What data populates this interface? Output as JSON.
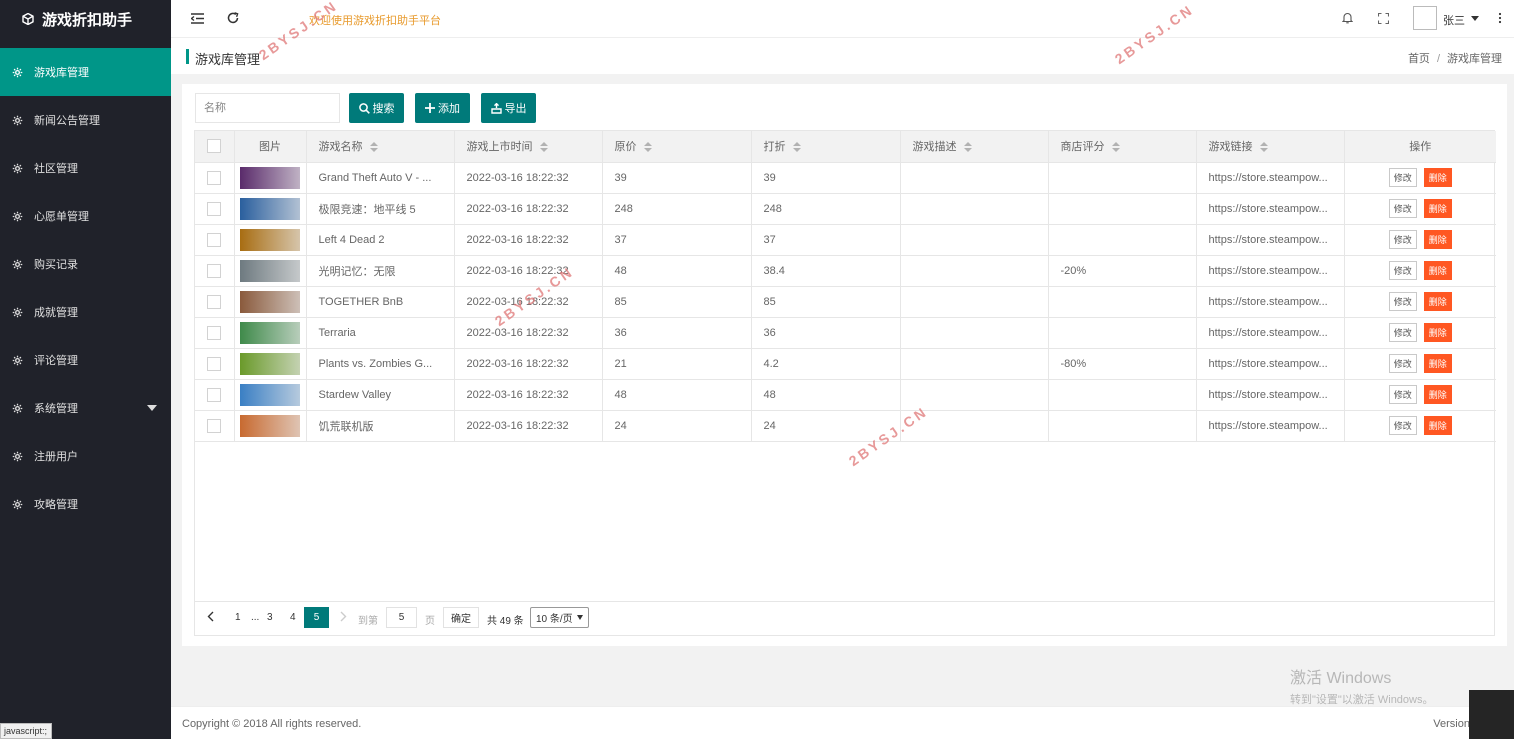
{
  "app": {
    "title": "游戏折扣助手"
  },
  "sidebar": {
    "items": [
      {
        "label": "游戏库管理",
        "active": true
      },
      {
        "label": "新闻公告管理"
      },
      {
        "label": "社区管理"
      },
      {
        "label": "心愿单管理"
      },
      {
        "label": "购买记录"
      },
      {
        "label": "成就管理"
      },
      {
        "label": "评论管理"
      },
      {
        "label": "系统管理",
        "expandable": true
      },
      {
        "label": "注册用户"
      },
      {
        "label": "攻略管理"
      }
    ]
  },
  "header": {
    "welcome": "欢迎使用游戏折扣助手平台",
    "user_name": "张三",
    "icons": [
      "menu-fold-icon",
      "refresh-icon",
      "bell-icon",
      "fullscreen-icon",
      "more-vertical-icon"
    ]
  },
  "page": {
    "title": "游戏库管理",
    "breadcrumb": [
      "首页",
      "游戏库管理"
    ]
  },
  "toolbar": {
    "search_placeholder": "名称",
    "search_label": "搜索",
    "add_label": "添加",
    "export_label": "导出"
  },
  "table": {
    "headers": {
      "image": "图片",
      "name": "游戏名称",
      "release": "游戏上市时间",
      "price": "原价",
      "discount": "打折",
      "desc": "游戏描述",
      "rating": "商店评分",
      "link": "游戏链接",
      "ops": "操作"
    },
    "edit_label": "修改",
    "delete_label": "删除",
    "rows": [
      {
        "name": "Grand Theft Auto V - ...",
        "release": "2022-03-16 18:22:32",
        "price": "39",
        "discount": "39",
        "desc": "",
        "rating": "",
        "link": "https://store.steampow...",
        "thumb_color": "#5a2b6b"
      },
      {
        "name": "极限竞速：地平线 5",
        "release": "2022-03-16 18:22:32",
        "price": "248",
        "discount": "248",
        "desc": "",
        "rating": "",
        "link": "https://store.steampow...",
        "thumb_color": "#2a5f9e"
      },
      {
        "name": "Left 4 Dead 2",
        "release": "2022-03-16 18:22:32",
        "price": "37",
        "discount": "37",
        "desc": "",
        "rating": "",
        "link": "https://store.steampow...",
        "thumb_color": "#a86d12"
      },
      {
        "name": "光明记忆：无限",
        "release": "2022-03-16 18:22:32",
        "price": "48",
        "discount": "38.4",
        "desc": "",
        "rating": "-20%",
        "link": "https://store.steampow...",
        "thumb_color": "#6e7a80"
      },
      {
        "name": "TOGETHER BnB",
        "release": "2022-03-16 18:22:32",
        "price": "85",
        "discount": "85",
        "desc": "",
        "rating": "",
        "link": "https://store.steampow...",
        "thumb_color": "#8a5a3c"
      },
      {
        "name": "Terraria",
        "release": "2022-03-16 18:22:32",
        "price": "36",
        "discount": "36",
        "desc": "",
        "rating": "",
        "link": "https://store.steampow...",
        "thumb_color": "#3f8a4a"
      },
      {
        "name": "Plants vs. Zombies G...",
        "release": "2022-03-16 18:22:32",
        "price": "21",
        "discount": "4.2",
        "desc": "",
        "rating": "-80%",
        "link": "https://store.steampow...",
        "thumb_color": "#6a9a2a"
      },
      {
        "name": "Stardew Valley",
        "release": "2022-03-16 18:22:32",
        "price": "48",
        "discount": "48",
        "desc": "",
        "rating": "",
        "link": "https://store.steampow...",
        "thumb_color": "#3a7fc4"
      },
      {
        "name": "饥荒联机版",
        "release": "2022-03-16 18:22:32",
        "price": "24",
        "discount": "24",
        "desc": "",
        "rating": "",
        "link": "https://store.steampow...",
        "thumb_color": "#c86a30"
      }
    ]
  },
  "pager": {
    "pages": [
      "1",
      "...",
      "3",
      "4"
    ],
    "current": "5",
    "goto_label": "到第",
    "goto_value": "5",
    "page_unit": "页",
    "confirm_label": "确定",
    "total": "共 49 条",
    "page_size": "10 条/页"
  },
  "footer": {
    "copyright": "Copyright © 2018 All rights reserved.",
    "version": "Version"
  },
  "overlay": {
    "activate_title": "激活 Windows",
    "activate_sub": "转到\"设置\"以激活 Windows。",
    "statusbar": "javascript:;",
    "watermark": "2BYSJ.CN"
  }
}
